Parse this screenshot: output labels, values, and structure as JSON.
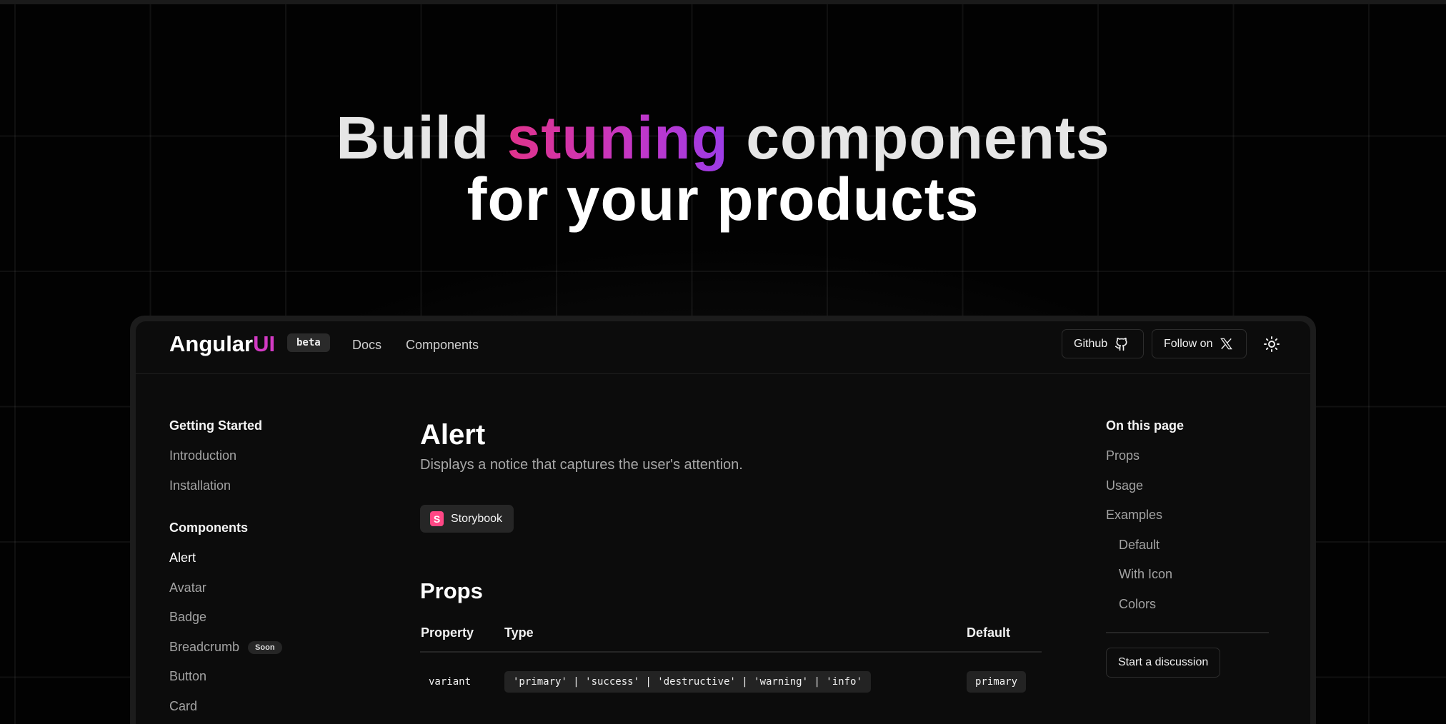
{
  "hero": {
    "line1_part1": "Build ",
    "line1_highlight": "stuning",
    "line1_part2": " components",
    "line2": "for your products"
  },
  "navbar": {
    "logo_main": "Angular",
    "logo_accent": "UI",
    "badge": "beta",
    "links": [
      "Docs",
      "Components"
    ],
    "github_label": "Github",
    "follow_label": "Follow on",
    "theme_icon": "sun-icon"
  },
  "sidebar": {
    "section1_title": "Getting Started",
    "section1_items": [
      "Introduction",
      "Installation"
    ],
    "section2_title": "Components",
    "section2_items": [
      "Alert",
      "Avatar",
      "Badge",
      "Breadcrumb",
      "Button",
      "Card"
    ],
    "soon_badge": "Soon"
  },
  "main": {
    "title": "Alert",
    "description": "Displays a notice that captures the user's attention.",
    "storybook_label": "Storybook",
    "props_heading": "Props",
    "table": {
      "headers": [
        "Property",
        "Type",
        "Default"
      ],
      "rows": [
        {
          "property": "variant",
          "type": "'primary' | 'success' | 'destructive' | 'warning' | 'info'",
          "default": "primary"
        }
      ]
    }
  },
  "toc": {
    "title": "On this page",
    "items": [
      "Props",
      "Usage",
      "Examples"
    ],
    "sub_items": [
      "Default",
      "With Icon",
      "Colors"
    ],
    "discussion_button": "Start a discussion"
  },
  "colors": {
    "accent": "#d23ac3",
    "gradient_start": "#e0338b",
    "gradient_end": "#9b3ce8",
    "storybook": "#ff4785"
  }
}
